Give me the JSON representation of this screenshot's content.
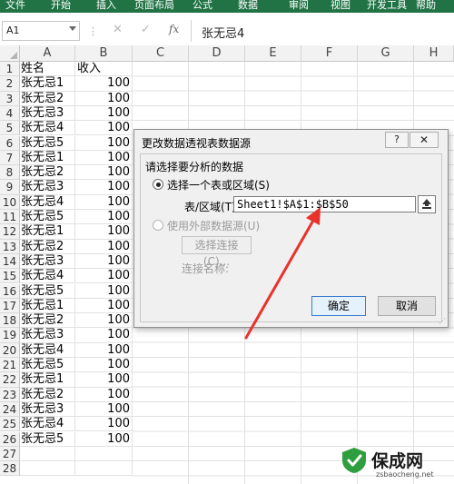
{
  "ribbon": {
    "tabs": [
      "文件",
      "开始",
      "插入",
      "页面布局",
      "公式",
      "数据",
      "审阅",
      "视图",
      "开发工具",
      "帮助"
    ]
  },
  "formula_bar": {
    "name_box": "A1",
    "fx": "fx",
    "value": "张无忌4"
  },
  "columns": [
    "A",
    "B",
    "C",
    "D",
    "E",
    "F",
    "G",
    "H"
  ],
  "rows": [
    {
      "n": "1",
      "a": "姓名",
      "b": "收入"
    },
    {
      "n": "2",
      "a": "张无忌1",
      "b": "100"
    },
    {
      "n": "3",
      "a": "张无忌2",
      "b": "100"
    },
    {
      "n": "4",
      "a": "张无忌3",
      "b": "100"
    },
    {
      "n": "5",
      "a": "张无忌4",
      "b": "100"
    },
    {
      "n": "6",
      "a": "张无忌5",
      "b": "100"
    },
    {
      "n": "7",
      "a": "张无忌1",
      "b": "100"
    },
    {
      "n": "8",
      "a": "张无忌2",
      "b": "100"
    },
    {
      "n": "9",
      "a": "张无忌3",
      "b": "100"
    },
    {
      "n": "10",
      "a": "张无忌4",
      "b": "100"
    },
    {
      "n": "11",
      "a": "张无忌5",
      "b": "100"
    },
    {
      "n": "12",
      "a": "张无忌1",
      "b": "100"
    },
    {
      "n": "13",
      "a": "张无忌2",
      "b": "100"
    },
    {
      "n": "14",
      "a": "张无忌3",
      "b": "100"
    },
    {
      "n": "15",
      "a": "张无忌4",
      "b": "100"
    },
    {
      "n": "16",
      "a": "张无忌5",
      "b": "100"
    },
    {
      "n": "17",
      "a": "张无忌1",
      "b": "100"
    },
    {
      "n": "18",
      "a": "张无忌2",
      "b": "100"
    },
    {
      "n": "19",
      "a": "张无忌3",
      "b": "100"
    },
    {
      "n": "20",
      "a": "张无忌4",
      "b": "100"
    },
    {
      "n": "21",
      "a": "张无忌5",
      "b": "100"
    },
    {
      "n": "22",
      "a": "张无忌1",
      "b": "100"
    },
    {
      "n": "23",
      "a": "张无忌2",
      "b": "100"
    },
    {
      "n": "24",
      "a": "张无忌3",
      "b": "100"
    },
    {
      "n": "25",
      "a": "张无忌4",
      "b": "100"
    },
    {
      "n": "26",
      "a": "张无忌5",
      "b": "100"
    },
    {
      "n": "27",
      "a": "",
      "b": ""
    },
    {
      "n": "28",
      "a": "",
      "b": ""
    }
  ],
  "dialog": {
    "title": "更改数据透视表数据源",
    "help": "?",
    "close": "✕",
    "group_title": "请选择要分析的数据",
    "option_range": "选择一个表或区域(S)",
    "range_label": "表/区域(T):",
    "range_value": "Sheet1!$A$1:$B$50",
    "option_external": "使用外部数据源(U)",
    "choose_connection": "选择连接(C)...",
    "connection_name": "连接名称:",
    "ok": "确定",
    "cancel": "取消"
  },
  "watermark": {
    "title": "保成网",
    "sub": "zsbaocheng.net"
  },
  "colors": {
    "ribbon": "#217346",
    "arrow": "#e8322c",
    "accent_button_border": "#3a7ad0"
  }
}
